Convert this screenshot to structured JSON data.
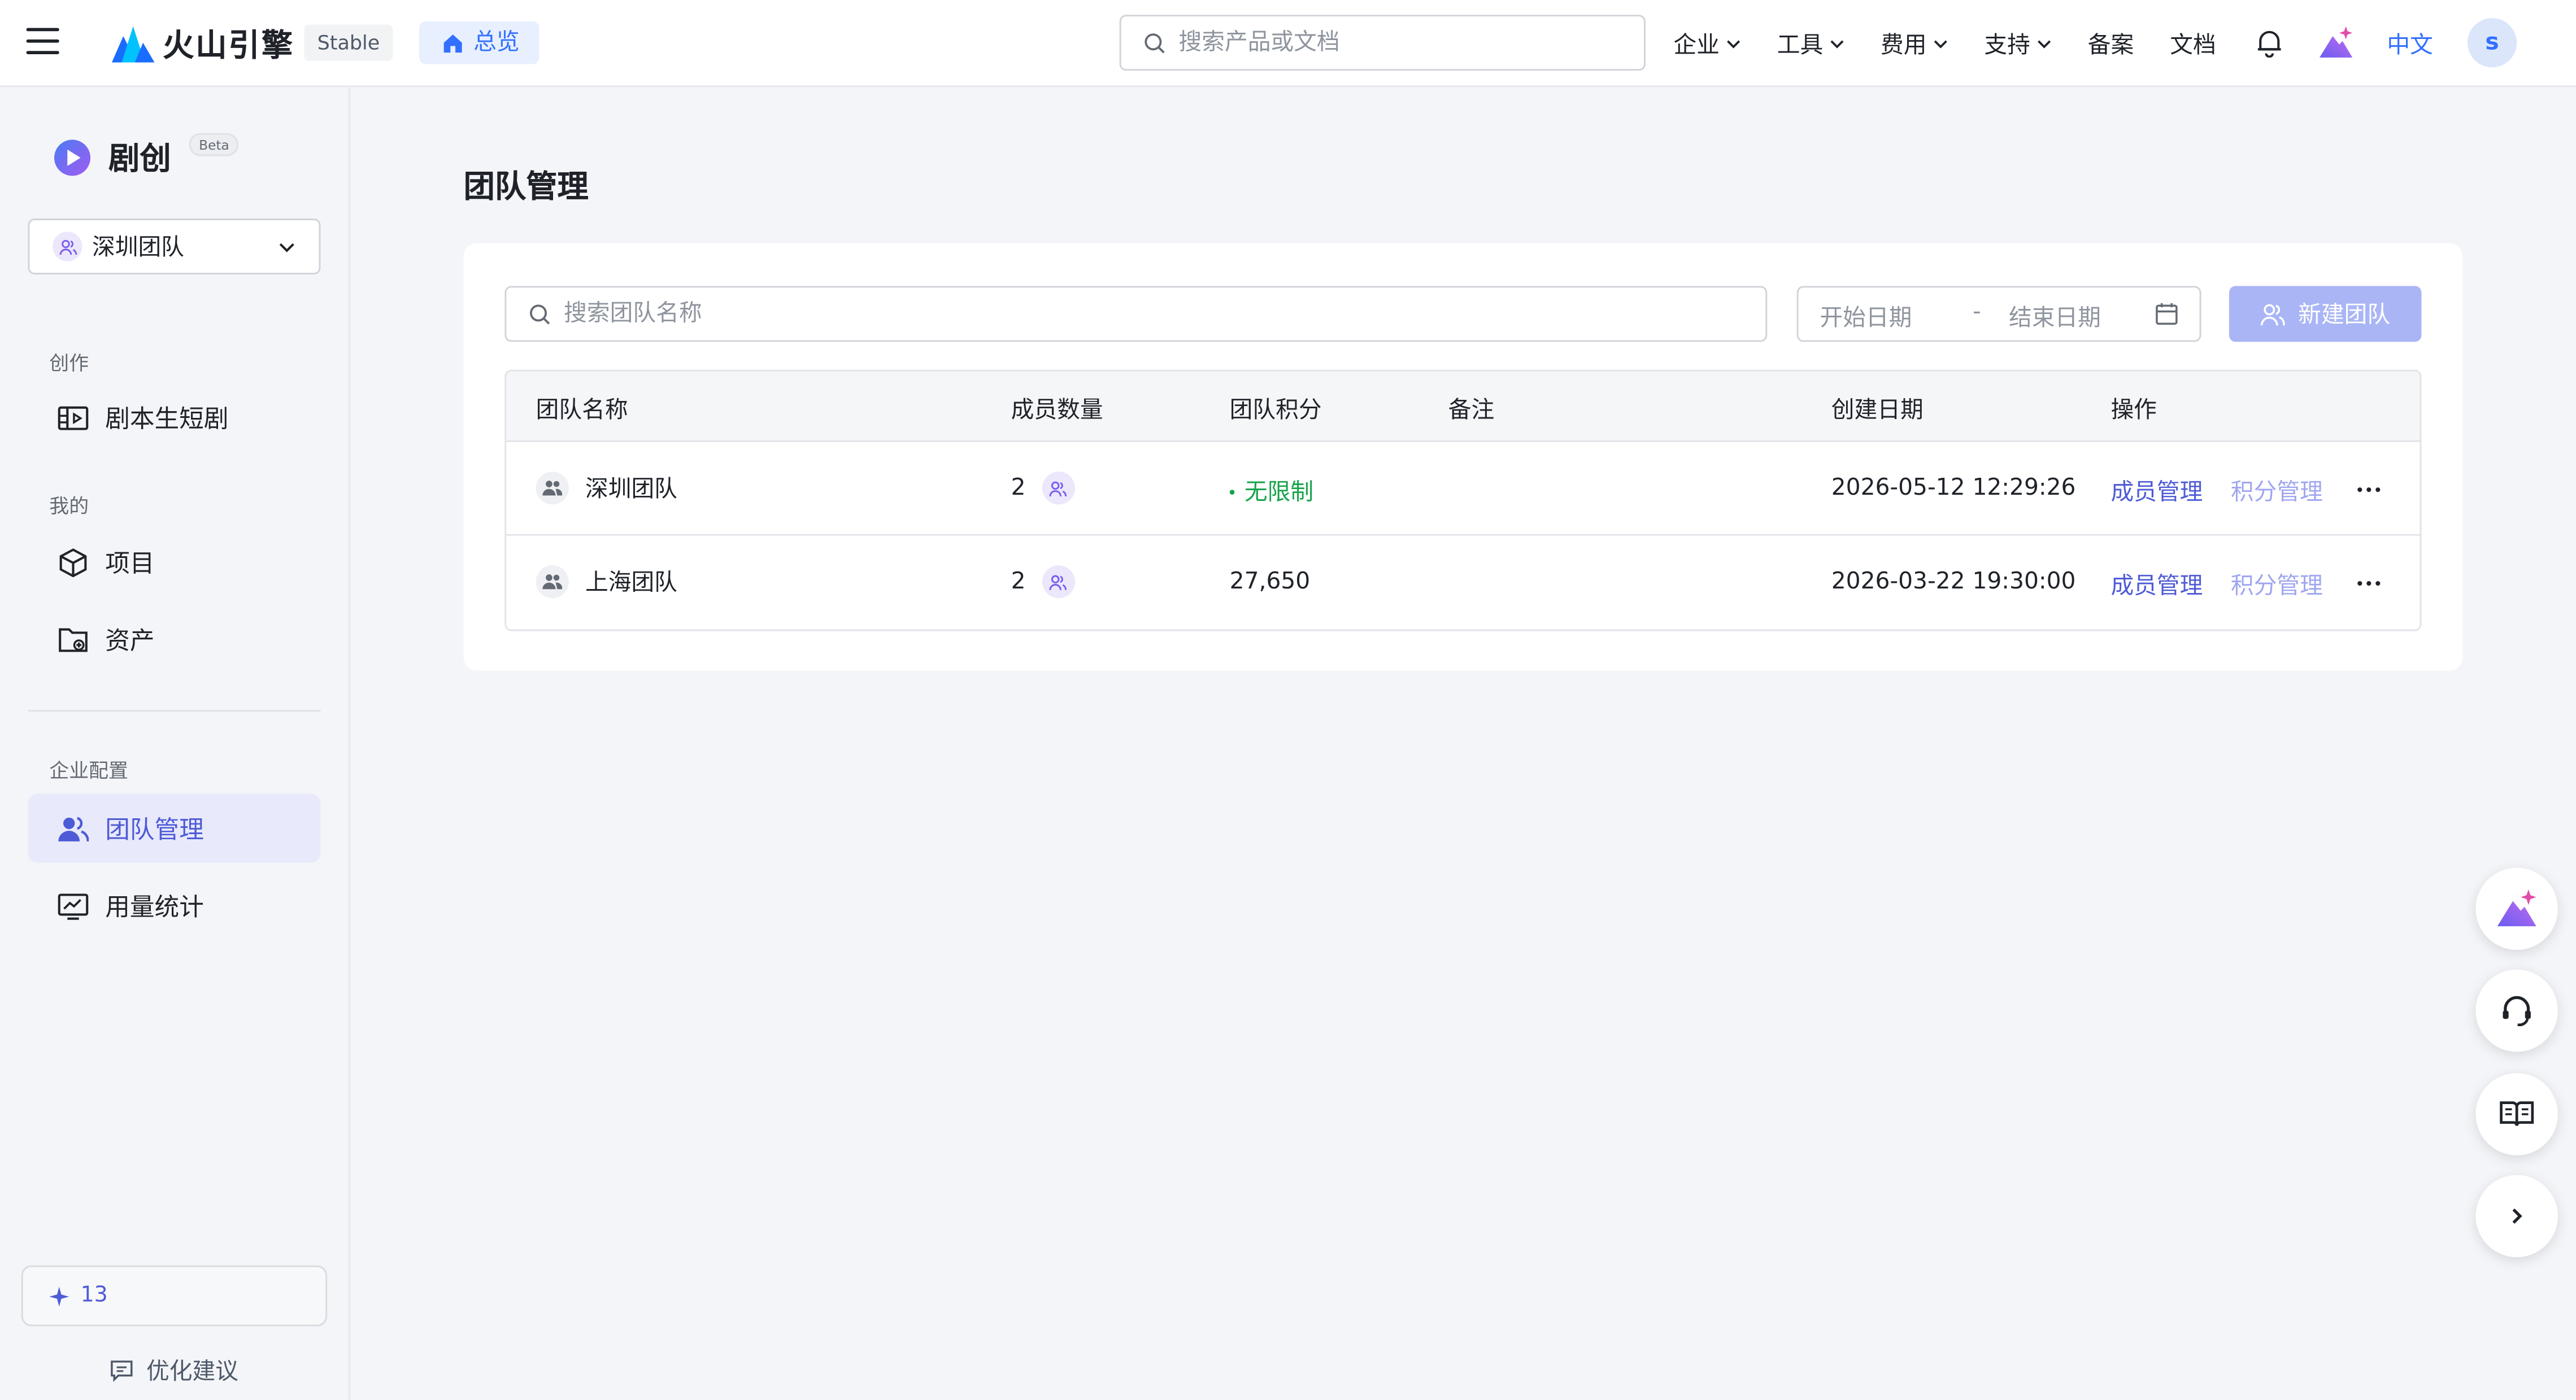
{
  "topbar": {
    "brand": "火山引擎",
    "stable_tag": "Stable",
    "overview_label": "总览",
    "search_placeholder": "搜索产品或文档",
    "nav": [
      {
        "label": "企业"
      },
      {
        "label": "工具"
      },
      {
        "label": "费用"
      },
      {
        "label": "支持"
      },
      {
        "label": "备案"
      },
      {
        "label": "文档"
      }
    ],
    "language": "中文",
    "avatar_initial": "s"
  },
  "sidebar": {
    "app_name": "剧创",
    "beta": "Beta",
    "team_selector": "深圳团队",
    "sections": {
      "create": "创作",
      "mine": "我的",
      "enterprise": "企业配置"
    },
    "items": {
      "script_short": "剧本生短剧",
      "projects": "项目",
      "assets": "资产",
      "team_mgmt": "团队管理",
      "usage_stats": "用量统计"
    },
    "credits": "13",
    "feedback": "优化建议"
  },
  "main": {
    "title": "团队管理",
    "search_placeholder": "搜索团队名称",
    "date_start": "开始日期",
    "date_sep": "-",
    "date_end": "结束日期",
    "new_team_button": "新建团队",
    "columns": {
      "name": "团队名称",
      "members": "成员数量",
      "points": "团队积分",
      "remark": "备注",
      "created": "创建日期",
      "actions": "操作"
    },
    "rows": [
      {
        "name": "深圳团队",
        "members": "2",
        "points": "无限制",
        "remark": "",
        "created": "2026-05-12 12:29:26",
        "action1": "成员管理",
        "action2": "积分管理"
      },
      {
        "name": "上海团队",
        "members": "2",
        "points": "27,650",
        "remark": "",
        "created": "2026-03-22 19:30:00",
        "action1": "成员管理",
        "action2": "积分管理"
      }
    ]
  },
  "colors": {
    "brand_blue": "#3370ff",
    "accent_purple": "#4e5bd6",
    "unlimited_green": "#16a34a"
  }
}
